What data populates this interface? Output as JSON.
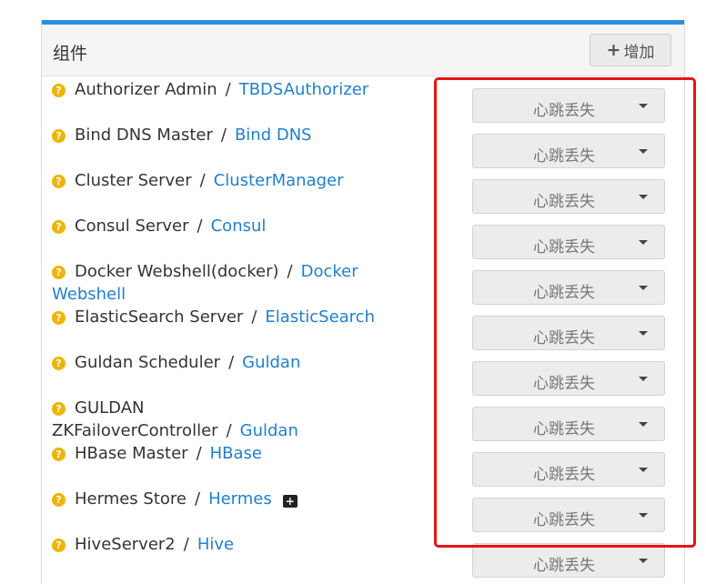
{
  "panel": {
    "title": "组件",
    "add_button_label": "增加",
    "accent_color": "#2d8fdd"
  },
  "rows": [
    {
      "component": "Authorizer Admin",
      "separator": "/",
      "service": "TBDSAuthorizer",
      "status": "心跳丢失"
    },
    {
      "component": "Bind DNS Master",
      "separator": "/",
      "service": "Bind DNS",
      "status": "心跳丢失"
    },
    {
      "component": "Cluster Server",
      "separator": "/",
      "service": "ClusterManager",
      "status": "心跳丢失"
    },
    {
      "component": "Consul Server",
      "separator": "/",
      "service": "Consul",
      "status": "心跳丢失"
    },
    {
      "component": "Docker Webshell(docker)",
      "separator": "/",
      "service": "Docker Webshell",
      "status": "心跳丢失"
    },
    {
      "component": "ElasticSearch Server",
      "separator": "/",
      "service": "ElasticSearch",
      "status": "心跳丢失"
    },
    {
      "component": "Guldan Scheduler",
      "separator": "/",
      "service": "Guldan",
      "status": "心跳丢失"
    },
    {
      "component": "GULDAN ZKFailoverController",
      "separator": "/",
      "service": "Guldan",
      "status": "心跳丢失"
    },
    {
      "component": "HBase Master",
      "separator": "/",
      "service": "HBase",
      "status": "心跳丢失"
    },
    {
      "component": "Hermes Store",
      "separator": "/",
      "service": "Hermes",
      "status": "心跳丢失",
      "icon": "medkit-icon"
    },
    {
      "component": "HiveServer2",
      "separator": "/",
      "service": "Hive",
      "status": "心跳丢失"
    }
  ],
  "icons": {
    "status": "question-circle-icon",
    "add": "plus-icon",
    "dropdown": "caret-down-icon"
  },
  "annotation": {
    "color": "#e81414"
  }
}
